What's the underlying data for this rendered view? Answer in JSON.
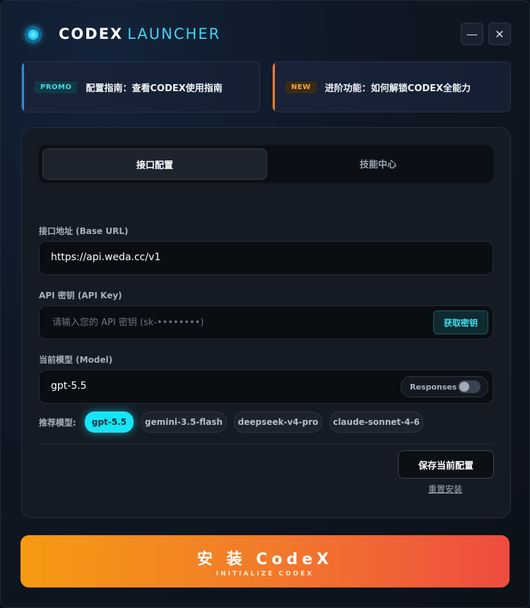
{
  "app": {
    "title_bold": "CODEX",
    "title_light": "LAUNCHER",
    "minimize_glyph": "—",
    "close_glyph": "✕"
  },
  "banners": [
    {
      "badge": "PROMO",
      "text": "配置指南：查看CODEX使用指南",
      "accent": "#2f8bd8",
      "badge_bg": "#103a44",
      "badge_color": "#40d7e8"
    },
    {
      "badge": "NEW",
      "text": "进阶功能：如何解锁CODEX全能力",
      "accent": "#f07a2a",
      "badge_bg": "#3a2c14",
      "badge_color": "#f2a93a"
    }
  ],
  "tabs": [
    {
      "label": "接口配置",
      "active": true
    },
    {
      "label": "技能中心",
      "active": false
    }
  ],
  "fields": {
    "base_url": {
      "label": "接口地址 (Base URL)",
      "value": "https://api.weda.cc/v1"
    },
    "api_key": {
      "label": "API 密钥 (API Key)",
      "placeholder": "请输入您的 API 密钥 (sk-••••••••)",
      "button": "获取密钥"
    },
    "model": {
      "label": "当前模型 (Model)",
      "value": "gpt-5.5",
      "toggle_label": "Responses",
      "toggle_on": false
    }
  },
  "recommended": {
    "label": "推荐模型:",
    "models": [
      "gpt-5.5",
      "gemini-3.5-flash",
      "deepseek-v4-pro",
      "claude-sonnet-4-6"
    ],
    "selected": "gpt-5.5"
  },
  "actions": {
    "save": "保存当前配置",
    "reset": "重置安装"
  },
  "install": {
    "label": "安 装 CodeX",
    "sublabel": "INITIALIZE CODEX"
  },
  "colors": {
    "accent": "#18e4f5",
    "install_start": "#f69a12",
    "install_end": "#ef4c40"
  }
}
